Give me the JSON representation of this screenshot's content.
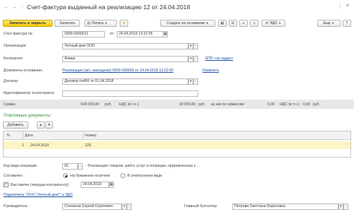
{
  "header": {
    "title": "Счет-фактура выданный на реализацию 12 от 24.04.2018",
    "more": "⋮",
    "close": "✕"
  },
  "toolbar": {
    "post_close": "Записать и закрыть",
    "save": "Записать",
    "print": "Печать",
    "create_based": "Создать на основании",
    "edo": "ЭДО",
    "more": "Еще",
    "help": "?"
  },
  "form": {
    "invoice_label": "Счет-фактура №:",
    "invoice_number": "0000-0000012",
    "from_label": "от:",
    "date": "24.04.2018 13:22:05",
    "org_label": "Организация:",
    "org": "Уютный дом ООО",
    "counterparty_label": "Контрагент:",
    "counterparty": "Алмаз",
    "kpp_link": "КПП <не задан>",
    "basis_label": "Документы-основания:",
    "basis_link": "Реализация (акт, накладная) 0000-000009 от 24.04.2018 13:22:05",
    "change_link": "Изменить",
    "contract_label": "Договор:",
    "contract": "Договор №456 от 01.04.2018",
    "gov_label": "Идентификатор госконтракта:",
    "gov": ""
  },
  "sums": {
    "sum_label": "Сумма:",
    "sum": "618 000,00",
    "cur1": "руб.",
    "vat_label": "НДС (в т.ч.):",
    "vat": "18 000,00",
    "commission_label": "из них по комиссии:",
    "commission": "0,00",
    "cur2": "руб.",
    "vat2_label": "НДС (в т.ч.):",
    "vat2": "0,00",
    "cur3": "руб."
  },
  "payments": {
    "section_title": "Платежные документы",
    "add_button": "Добавить",
    "columns": [
      "N",
      "Дата",
      "Номер"
    ],
    "rows": [
      {
        "n": "1",
        "date": "24.04.2018",
        "number": "125"
      }
    ]
  },
  "bottom": {
    "op_code_label": "Код вида операции:",
    "op_code": "01",
    "op_desc": "Реализация товаров, работ, услуг и операции, приравненные к ...",
    "composed_label": "Составлен:",
    "paper": "На бумажном носителе",
    "electronic": "В электронном виде",
    "issued_label": "Выставлен (передан контрагенту):",
    "issued_date": "24.04.2018",
    "connect_link": "Подключить \"ООО \"Уютный дом\"\" к ЭДО",
    "manager_label": "Руководитель:",
    "manager": "Степанов Сергей Сергеевич",
    "accountant_label": "Главный бухгалтер:",
    "accountant": "Петрова Светлана Борисовна"
  },
  "colors": {
    "accent_yellow": "#f6c800",
    "section_green": "#3a8f3a",
    "link_blue": "#1a4f9c",
    "row_highlight": "#fdf3c4"
  }
}
